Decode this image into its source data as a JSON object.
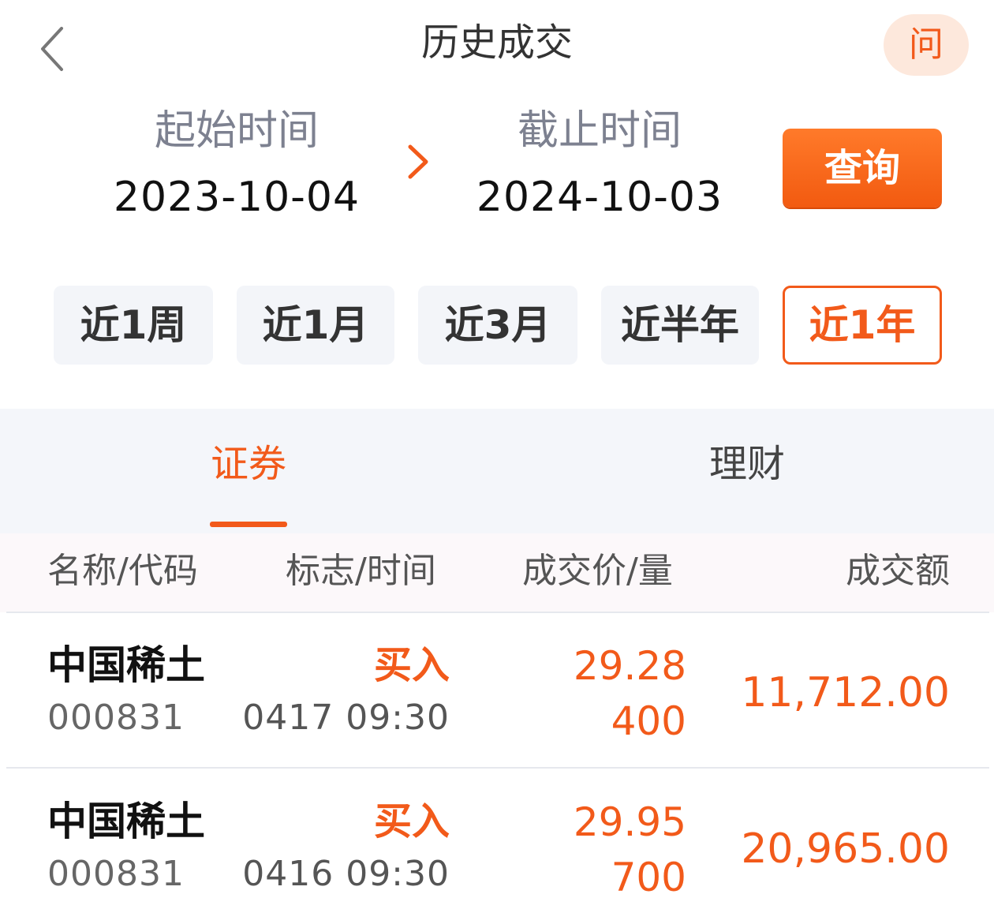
{
  "header": {
    "title": "历史成交",
    "help_label": "问"
  },
  "date_range": {
    "start_label": "起始时间",
    "start_value": "2023-10-04",
    "end_label": "截止时间",
    "end_value": "2024-10-03",
    "query_label": "查询"
  },
  "periods": {
    "items": [
      "近1周",
      "近1月",
      "近3月",
      "近半年",
      "近1年"
    ],
    "active": "近1年"
  },
  "tabs": {
    "items": [
      "证券",
      "理财"
    ],
    "active": "证券"
  },
  "table": {
    "columns": [
      "名称/代码",
      "标志/时间",
      "成交价/量",
      "成交额"
    ],
    "rows": [
      {
        "name": "中国稀土",
        "code": "000831",
        "side": "买入",
        "datetime": "0417 09:30",
        "price": "29.28",
        "quantity": "400",
        "amount": "11,712.00"
      },
      {
        "name": "中国稀土",
        "code": "000831",
        "side": "买入",
        "datetime": "0416 09:30",
        "price": "29.95",
        "quantity": "700",
        "amount": "20,965.00"
      }
    ]
  },
  "colors": {
    "accent": "#f25a1a",
    "chip_bg": "#f3f5f9",
    "tabs_bg": "#f4f6fa"
  }
}
